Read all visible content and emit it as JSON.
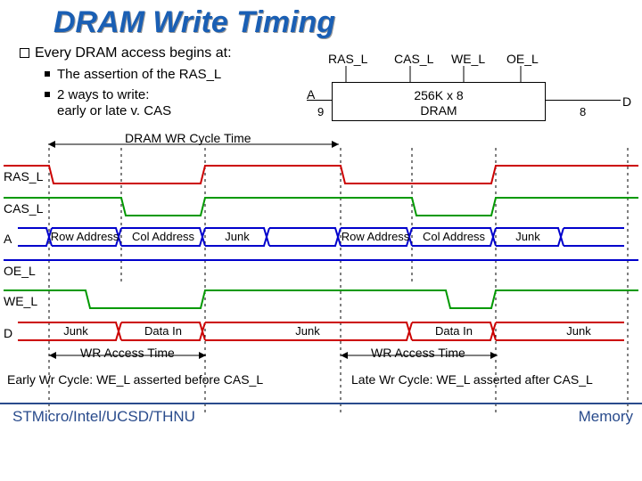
{
  "title": "DRAM Write Timing",
  "lead": {
    "prefix": "Every ",
    "rest": "DRAM access begins at:"
  },
  "sub1": "The assertion of the RAS_L",
  "sub2": {
    "l1": "2 ways to write:",
    "l2": "early or late v. CAS"
  },
  "pins": {
    "ras": "RAS_L",
    "cas": "CAS_L",
    "we": "WE_L",
    "oe": "OE_L"
  },
  "block": {
    "l1": "256K x 8",
    "l2": "DRAM"
  },
  "bus": {
    "a": "A",
    "a_w": "9",
    "d": "D",
    "d_w": "8"
  },
  "cycle_label": "DRAM WR Cycle Time",
  "rows": {
    "ras": "RAS_L",
    "cas": "CAS_L",
    "a": "A",
    "oe": "OE_L",
    "we": "WE_L",
    "d": "D"
  },
  "seg": {
    "row_addr": "Row Address",
    "col_addr": "Col Address",
    "junk": "Junk",
    "data_in": "Data In",
    "wr_access": "WR Access Time"
  },
  "caption": {
    "early": "Early Wr Cycle: WE_L asserted before CAS_L",
    "late": "Late Wr Cycle: WE_L asserted after CAS_L"
  },
  "footer": {
    "left": "STMicro/Intel/UCSD/THNU",
    "right": "Memory"
  }
}
